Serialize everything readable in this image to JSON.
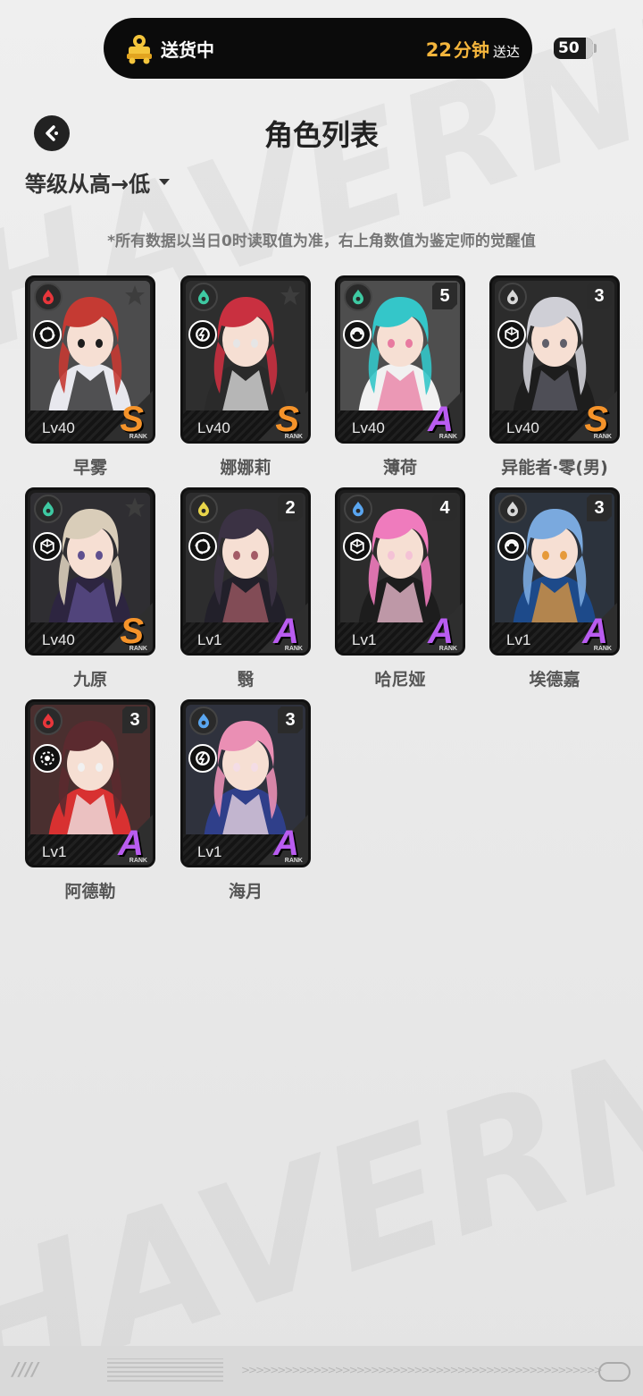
{
  "status": {
    "label": "送货中",
    "eta_number": "22",
    "eta_unit": "分钟",
    "eta_suffix": "送达",
    "icon": "delivery-icon"
  },
  "battery": {
    "level": "50"
  },
  "header": {
    "title": "角色列表",
    "back_icon": "back-arrow-icon"
  },
  "sort": {
    "selected": "等级从高→低",
    "icon": "caret-down-icon"
  },
  "note": "*所有数据以当日0时读取值为准，右上角数值为鉴定师的觉醒值",
  "rank_word": "RANK",
  "characters": [
    {
      "name": "早雾",
      "level": "Lv40",
      "rank": "S",
      "awakening": "",
      "attribute": "fire",
      "attr_color": "#e8363b",
      "role": "anomaly",
      "palette": [
        "#c53a33",
        "#e8e8ee",
        "#1d1d1d"
      ]
    },
    {
      "name": "娜娜莉",
      "level": "Lv40",
      "rank": "S",
      "awakening": "",
      "attribute": "ether",
      "attr_color": "#3ec9a2",
      "role": "stun",
      "palette": [
        "#c93040",
        "#2a2a2a",
        "#e6e6e6"
      ]
    },
    {
      "name": "薄荷",
      "level": "Lv40",
      "rank": "A",
      "awakening": "5",
      "attribute": "ether",
      "attr_color": "#3ec9a2",
      "role": "support",
      "palette": [
        "#34c6c9",
        "#f1f1f1",
        "#e87aa0"
      ]
    },
    {
      "name": "异能者·零(男)",
      "level": "Lv40",
      "rank": "S",
      "awakening": "3",
      "attribute": "physical",
      "attr_color": "#d8d8d8",
      "role": "defense",
      "palette": [
        "#cfcfd6",
        "#1d1d1d",
        "#5f5f6a"
      ]
    },
    {
      "name": "九原",
      "level": "Lv40",
      "rank": "S",
      "awakening": "",
      "attribute": "ether",
      "attr_color": "#3ec9a2",
      "role": "defense",
      "palette": [
        "#d9cdb9",
        "#2d2540",
        "#5e4f8f"
      ]
    },
    {
      "name": "翳",
      "level": "Lv1",
      "rank": "A",
      "awakening": "2",
      "attribute": "electric",
      "attr_color": "#e8d54a",
      "role": "anomaly",
      "palette": [
        "#3b3244",
        "#22202a",
        "#a35b66"
      ]
    },
    {
      "name": "哈尼娅",
      "level": "Lv1",
      "rank": "A",
      "awakening": "4",
      "attribute": "ice",
      "attr_color": "#5aa6f0",
      "role": "defense",
      "palette": [
        "#ef7bbd",
        "#1d1d1d",
        "#f4c2d6"
      ]
    },
    {
      "name": "埃德嘉",
      "level": "Lv1",
      "rank": "A",
      "awakening": "3",
      "attribute": "physical",
      "attr_color": "#d8d8d8",
      "role": "support",
      "palette": [
        "#7aa9de",
        "#1d4a8a",
        "#e69a3a"
      ]
    },
    {
      "name": "阿德勒",
      "level": "Lv1",
      "rank": "A",
      "awakening": "3",
      "attribute": "fire",
      "attr_color": "#e8363b",
      "role": "attack",
      "palette": [
        "#5b2a2f",
        "#d83131",
        "#f1f1f1"
      ]
    },
    {
      "name": "海月",
      "level": "Lv1",
      "rank": "A",
      "awakening": "3",
      "attribute": "ice",
      "attr_color": "#5aa6f0",
      "role": "stun",
      "palette": [
        "#ea8fb4",
        "#2f3f8a",
        "#f4dde6"
      ]
    }
  ]
}
